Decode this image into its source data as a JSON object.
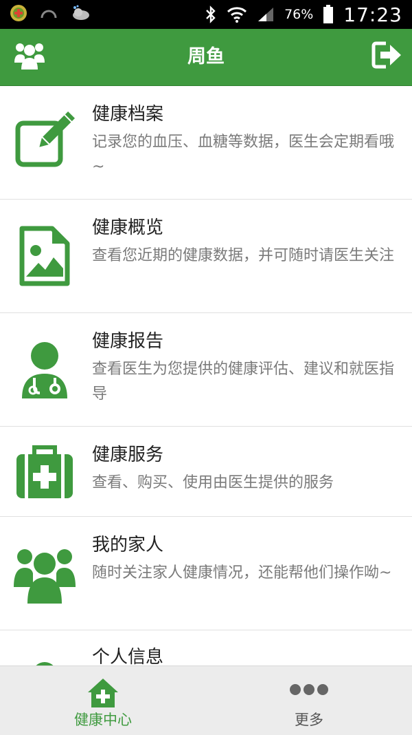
{
  "status_bar": {
    "battery": "76%",
    "time": "17:23"
  },
  "header": {
    "title": "周鱼"
  },
  "items": [
    {
      "title": "健康档案",
      "desc": "记录您的血压、血糖等数据，医生会定期看哦~",
      "icon": "edit-icon"
    },
    {
      "title": "健康概览",
      "desc": "查看您近期的健康数据，并可随时请医生关注",
      "icon": "image-file-icon"
    },
    {
      "title": "健康报告",
      "desc": "查看医生为您提供的健康评估、建议和就医指导",
      "icon": "doctor-icon"
    },
    {
      "title": "健康服务",
      "desc": "查看、购买、使用由医生提供的服务",
      "icon": "medical-kit-icon"
    },
    {
      "title": "我的家人",
      "desc": "随时关注家人健康情况，还能帮他们操作呦~",
      "icon": "family-icon"
    },
    {
      "title": "个人信息",
      "desc": "",
      "icon": "user-icon"
    }
  ],
  "tabs": [
    {
      "label": "健康中心",
      "icon": "home-plus-icon",
      "active": true
    },
    {
      "label": "更多",
      "icon": "more-dots-icon",
      "active": false
    }
  ],
  "colors": {
    "brand_green": "#3f9a3f"
  }
}
